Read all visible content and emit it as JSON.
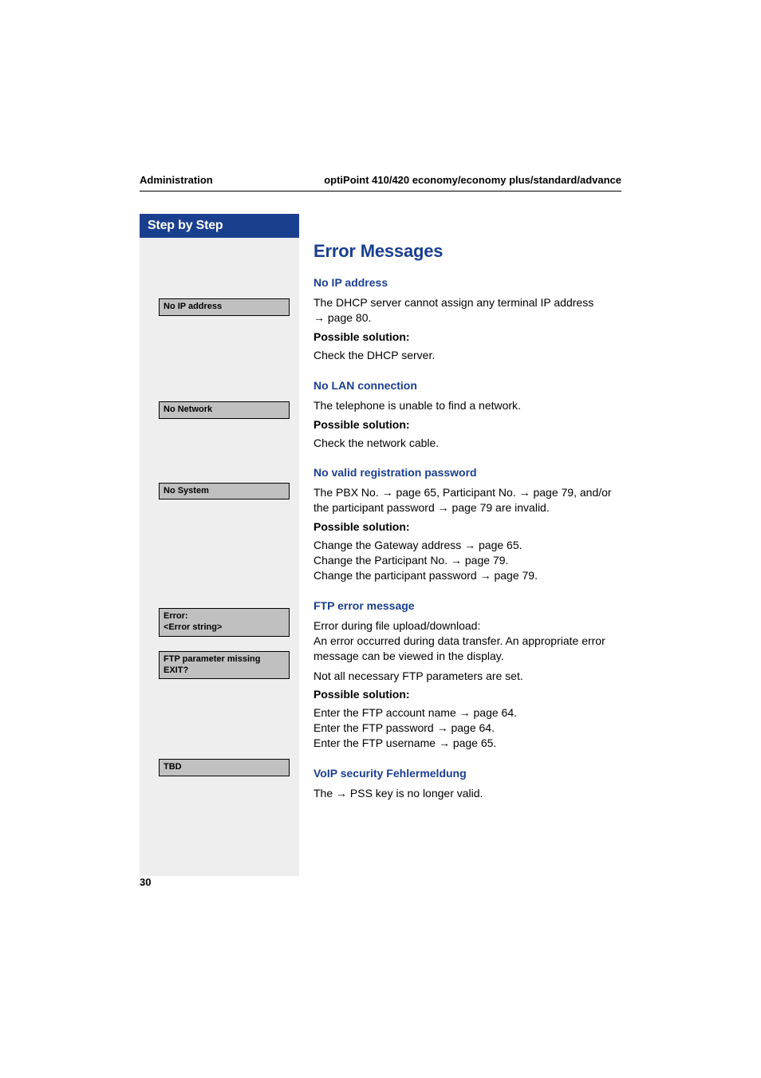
{
  "header": {
    "left": "Administration",
    "right": "optiPoint 410/420 economy/economy plus/standard/advance"
  },
  "sidebar": {
    "title": "Step by Step",
    "boxes": {
      "noip": "No IP address",
      "nonet": "No Network",
      "nosys": "No System",
      "error1": "Error:",
      "error2": "<Error string>",
      "ftp1": "FTP parameter missing",
      "ftp2": "EXIT?",
      "tbd": "TBD"
    }
  },
  "main": {
    "heading": "Error Messages",
    "sec1": {
      "title": "No IP address",
      "line1a": "The DHCP server cannot assign any terminal IP address ",
      "line1b": " page 80.",
      "sol_label": "Possible solution:",
      "sol_text": "Check the DHCP server."
    },
    "sec2": {
      "title": "No LAN connection",
      "line1": "The telephone is unable to find a network.",
      "sol_label": "Possible solution:",
      "sol_text": "Check the network cable."
    },
    "sec3": {
      "title": "No valid registration password",
      "l1a": "The PBX No. ",
      "l1b": " page 65, Participant No. ",
      "l1c": " page 79, and/or the participant password ",
      "l1d": " page 79 are invalid.",
      "sol_label": "Possible solution:",
      "s1a": "Change the Gateway address ",
      "s1b": " page 65.",
      "s2a": "Change the Participant No. ",
      "s2b": " page 79.",
      "s3a": "Change the participant password ",
      "s3b": " page 79."
    },
    "sec4": {
      "title": "FTP error message",
      "line1": "Error during file upload/download:",
      "line2": "An error occurred during data transfer. An appropriate error message can be viewed in the display.",
      "line3": "Not all necessary FTP parameters are set.",
      "sol_label": "Possible solution:",
      "s1a": "Enter the FTP account name ",
      "s1b": " page 64.",
      "s2a": "Enter the FTP password ",
      "s2b": " page 64.",
      "s3a": "Enter the FTP username ",
      "s3b": " page 65."
    },
    "sec5": {
      "title": "VoIP security Fehlermeldung",
      "l1a": "The ",
      "l1b": " PSS key is no longer valid."
    }
  },
  "arrow": "→",
  "page_number": "30"
}
